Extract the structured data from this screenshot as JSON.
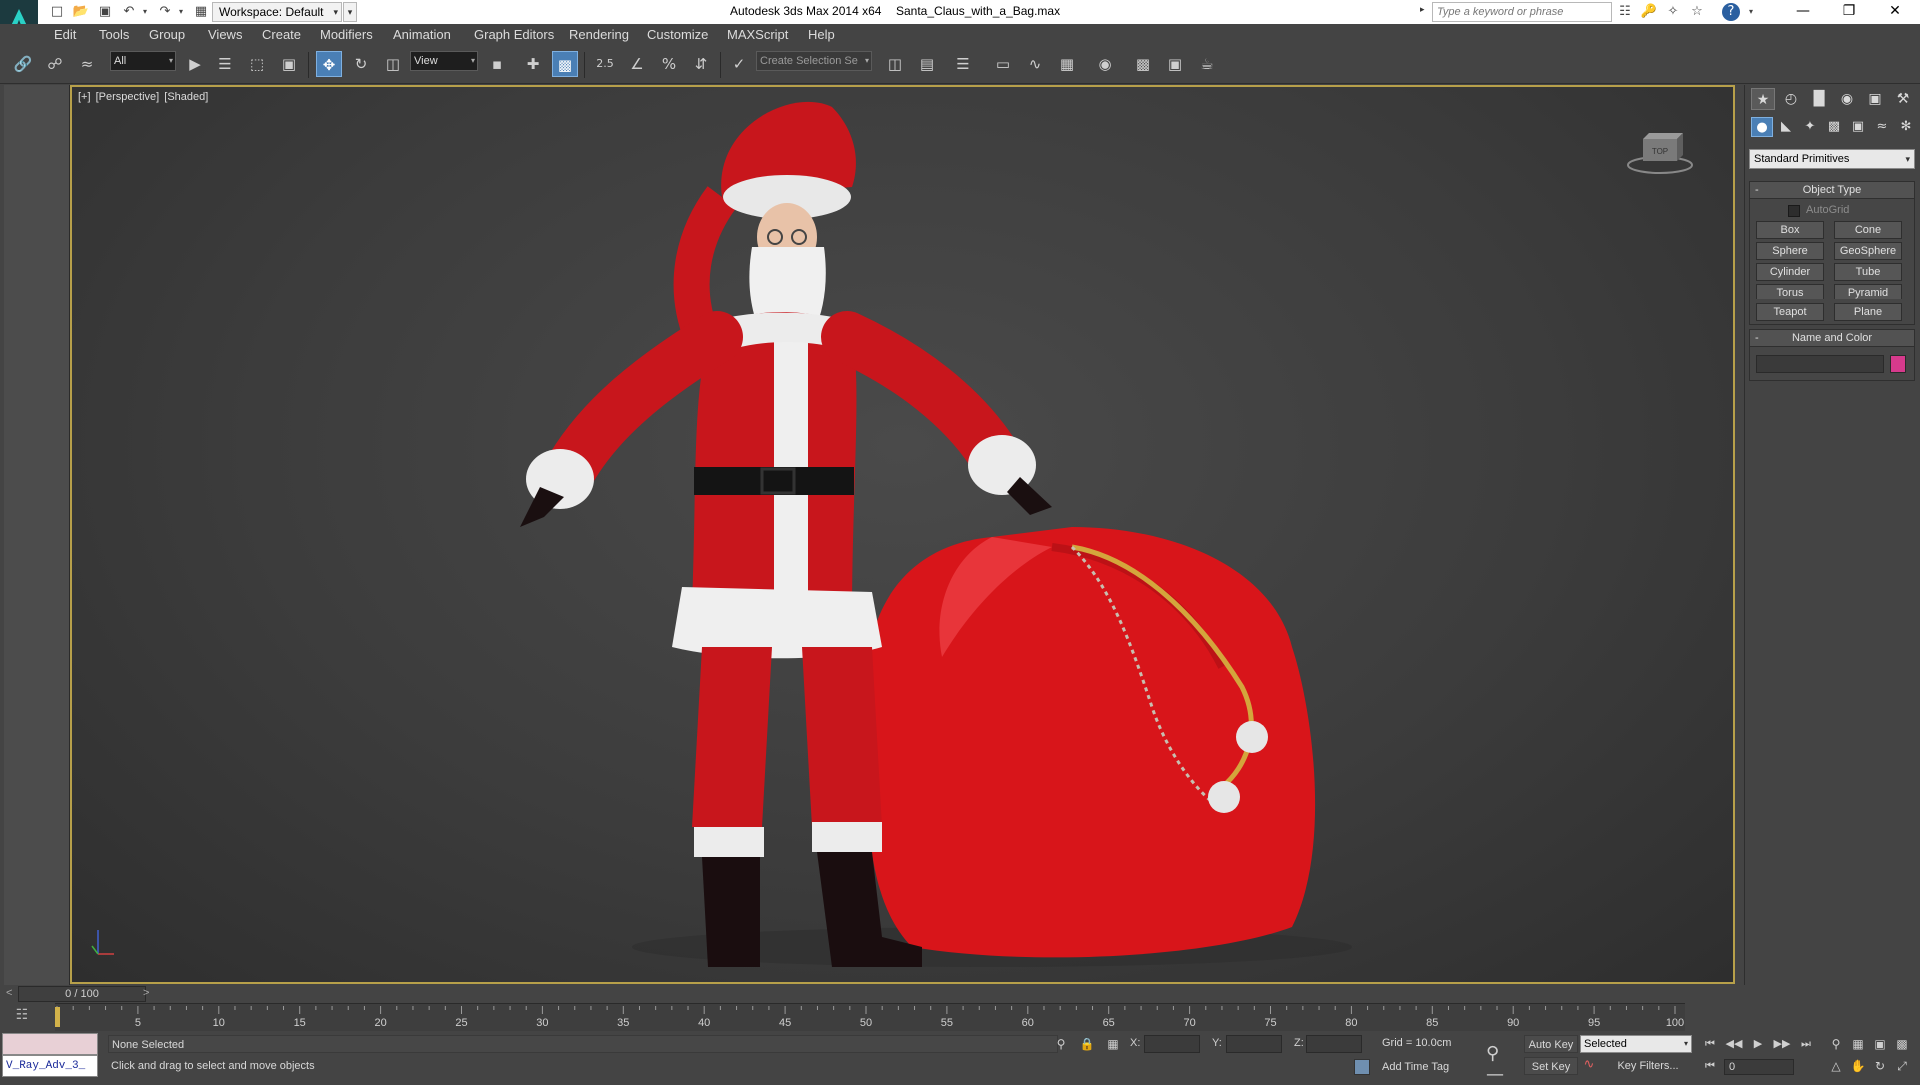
{
  "titlebar": {
    "workspace_label": "Workspace: Default",
    "app_title": "Autodesk 3ds Max  2014 x64",
    "file_title": "Santa_Claus_with_a_Bag.max",
    "search_placeholder": "Type a keyword or phrase",
    "icons": [
      "app-logo-icon",
      "new-file-icon",
      "open-file-icon",
      "save-file-icon",
      "undo-icon",
      "redo-icon",
      "project-folder-icon",
      "infocenter-search-icon",
      "communication-center-icon",
      "favorites-star-icon",
      "help-icon",
      "minimize-icon",
      "restore-icon",
      "close-icon"
    ]
  },
  "menubar": {
    "items": [
      "Edit",
      "Tools",
      "Group",
      "Views",
      "Create",
      "Modifiers",
      "Animation",
      "Graph Editors",
      "Rendering",
      "Customize",
      "MAXScript",
      "Help"
    ]
  },
  "toolbar": {
    "selection_filter": "All",
    "ref_coord": "View",
    "snap_angle_label": "2.5",
    "named_selection_placeholder": "Create Selection Se",
    "active_tool": "select-and-move"
  },
  "viewport": {
    "label_parts": [
      "[+]",
      "[Perspective]",
      "[Shaded]"
    ],
    "viewcube_label": "TOP",
    "border_color": "#b7a04a"
  },
  "command_panel": {
    "category": "Standard Primitives",
    "object_type_title": "Object Type",
    "autogrid_label": "AutoGrid",
    "primitives": [
      "Box",
      "Cone",
      "Sphere",
      "GeoSphere",
      "Cylinder",
      "Tube",
      "Torus",
      "Pyramid",
      "Teapot",
      "Plane"
    ],
    "name_color_title": "Name and Color",
    "object_color": "#d63a8c"
  },
  "timeslider": {
    "position_label": "0 / 100",
    "left_arrow": "<",
    "right_arrow": ">"
  },
  "trackbar": {
    "ticks": [
      5,
      10,
      15,
      20,
      25,
      30,
      35,
      40,
      45,
      50,
      55,
      60,
      65,
      70,
      75,
      80,
      85,
      90,
      95,
      100
    ]
  },
  "statusbar": {
    "maxscript_text": "V_Ray_Adv_3_",
    "selection_status": "None Selected",
    "prompt": "Click and drag to select and move objects",
    "x_label": "X:",
    "y_label": "Y:",
    "z_label": "Z:",
    "grid_label": "Grid = 10.0cm",
    "add_time_tag": "Add Time Tag",
    "auto_key": "Auto Key",
    "set_key": "Set Key",
    "key_mode": "Selected",
    "key_filters": "Key Filters...",
    "current_frame": "0"
  },
  "colors": {
    "ui_background": "#444444",
    "viewport_active_border": "#b7a04a",
    "active_button": "#4a7fb5"
  }
}
